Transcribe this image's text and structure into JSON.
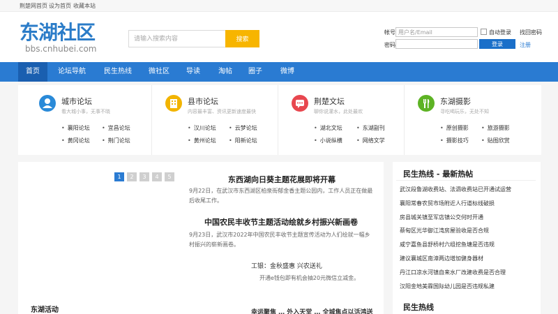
{
  "topbar": {
    "links": [
      "荆楚网首页",
      "设为首页",
      "收藏本站"
    ]
  },
  "logo": {
    "text": "东湖社区",
    "url_text": "bbs.cnhubei.com"
  },
  "search": {
    "placeholder": "请输入搜索内容",
    "button_label": "搜索"
  },
  "login": {
    "account_label": "帐号",
    "account_placeholder": "用户名/Email",
    "password_label": "密码",
    "auto_login_label": "自动登录",
    "forgot_password_label": "找回密码",
    "login_button_label": "登录",
    "register_label": "注册"
  },
  "nav": {
    "items": [
      "首页",
      "论坛导航",
      "民生热线",
      "微社区",
      "导读",
      "淘帖",
      "圈子",
      "微博"
    ],
    "active_index": 0
  },
  "forums": [
    {
      "title": "城市论坛",
      "desc": "看大城小事，无事不晓",
      "icon": "user-icon",
      "color": "#2a8ad8",
      "links": [
        "襄阳论坛",
        "宜昌论坛",
        "黄冈论坛",
        "荆门论坛"
      ]
    },
    {
      "title": "县市论坛",
      "desc": "内容最丰富、资讯更新速度最快",
      "icon": "building-icon",
      "color": "#f2b400",
      "links": [
        "汉川论坛",
        "云梦论坛",
        "黄州论坛",
        "阳新论坛"
      ]
    },
    {
      "title": "荆楚文坛",
      "desc": "聊你说灌水，此处最欢",
      "icon": "chat-icon",
      "color": "#e8474f",
      "links": [
        "湖北文坛",
        "东湖副刊",
        "小说纵横",
        "网络文学"
      ]
    },
    {
      "title": "东湖摄影",
      "desc": "寻吃喝玩乐，无处不知",
      "icon": "fork-knife-icon",
      "color": "#5db324",
      "links": [
        "原创摄影",
        "旅游摄影",
        "摄影技巧",
        "贴图欣赏"
      ]
    }
  ],
  "slider": {
    "pages": [
      "1",
      "2",
      "3",
      "4",
      "5"
    ],
    "active_page": 0
  },
  "news": [
    {
      "title": "东西湖向日葵主题花展即将开幕",
      "summary": "9月22日，在武汉市东西湖区柏泉街郁金香主题公园内，工作人员正在做最后收尾工作。"
    },
    {
      "title": "中国农民丰收节主题活动绘就乡村振兴新画卷",
      "summary": "9月23日，武汉市2022年中国农民丰收节主题宣传活动为人们绘就一幅乡村振兴的崭新画卷。"
    }
  ],
  "promo": {
    "title": "工银：金秋盛惠 兴农送礼",
    "summary": "开通e钱包即有机会抽20元微信立减金。"
  },
  "donghu_activity": {
    "title": "东湖活动",
    "partial_headline": "幸运聚焦 … 外入天堂 … 全城焦点以活鸿送"
  },
  "side": {
    "hotline_title": "民生热线 - 最新热帖",
    "hotline_items": [
      "武汉段鲁湖收费站、法泗收费站已开通试运营",
      "襄阳常春农贸市场附近人行道标线破损",
      "房县城关镇至军店镇公交何时开通",
      "蔡甸区光华御江湾房屋验收是否合规",
      "咸宁嘉鱼县舒桥村六组挖鱼塘是否违规",
      "建议襄城区南漳两边增加健身器材",
      "丹江口凉水河镇自来水厂改建收费是否合理",
      "汉阳金地美霖国际幼儿园是否违规私建"
    ],
    "section2_title": "民生热线"
  }
}
